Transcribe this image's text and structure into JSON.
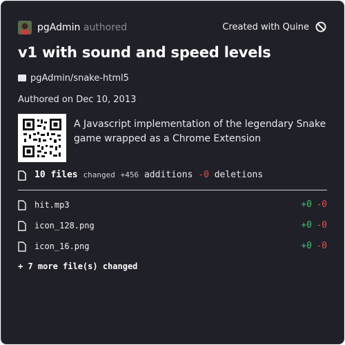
{
  "header": {
    "author_name": "pgAdmin",
    "author_role": "authored",
    "created_with": "Created with Quine"
  },
  "title": "v1 with sound and speed levels",
  "repo": "pgAdmin/snake-html5",
  "date": "Authored on Dec 10, 2013",
  "description": "A Javascript implementation of the legendary Snake game wrapped as a Chrome Extension",
  "summary": {
    "files_count": "10 files",
    "changed": "changed",
    "additions_value": "+456",
    "additions_label": "additions",
    "deletions_value": "-0",
    "deletions_label": "deletions"
  },
  "files": [
    {
      "name": "hit.mp3",
      "additions": "+0",
      "deletions": "-0"
    },
    {
      "name": "icon_128.png",
      "additions": "+0",
      "deletions": "-0"
    },
    {
      "name": "icon_16.png",
      "additions": "+0",
      "deletions": "-0"
    }
  ],
  "more_files": "+ 7 more file(s) changed",
  "colors": {
    "background": "#202028",
    "additions": "#3fbf6f",
    "deletions": "#e05050"
  },
  "icons": [
    "avatar",
    "quine-icon",
    "folder-icon",
    "qr-code",
    "document-icon",
    "file-icon"
  ]
}
